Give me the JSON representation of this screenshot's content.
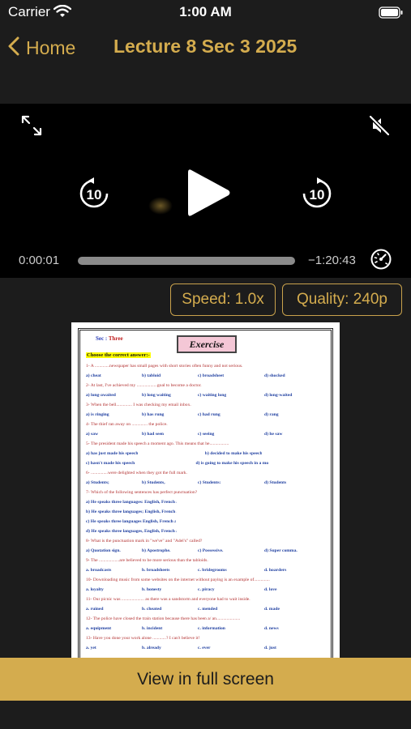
{
  "status": {
    "carrier": "Carrier",
    "time": "1:00 AM"
  },
  "nav": {
    "back_label": "Home",
    "title": "Lecture 8 Sec 3 2025"
  },
  "player": {
    "elapsed": "0:00:01",
    "remaining": "−1:20:43",
    "progress": 0.0002,
    "skip_back": "10",
    "skip_forward": "10"
  },
  "controls": {
    "speed": "Speed: 1.0x",
    "quality": "Quality: 240p"
  },
  "document": {
    "sec_label": "Sec :",
    "sec_value": "Three",
    "heading": "Exercise",
    "instruction": "Choose the correct answer:-",
    "questions": [
      {
        "q": "1- A .............newspaper has small pages with short stories often funny and not serious.",
        "options": [
          "a) cheat",
          "b) tabloid",
          "c) broadsheet",
          "d) shocked"
        ]
      },
      {
        "q": "2- At last, I've achieved my ..................goal to become a doctor.",
        "options": [
          "a) long-awaited",
          "b) long waiting",
          "c) waiting long",
          "d) long-waited"
        ]
      },
      {
        "q": "3- When the bell.............. I was checking my email inbox.",
        "options": [
          "a) is ringing",
          "b) has rung",
          "c) had rung",
          "d) rang"
        ]
      },
      {
        "q": "4- The thief ran away on .............. the police.",
        "options": [
          "a) saw",
          "b) had seen",
          "c) seeing",
          "d) he saw"
        ]
      },
      {
        "q": "5- The president made his speech a moment ago. This means that he.................",
        "options": [
          "a) has just made his speech",
          "",
          "b) decided to make his speech",
          ""
        ]
      },
      {
        "q": "",
        "options": [
          "c) hasn't made his speech yet",
          "",
          "d) is going to make his speech in a moment",
          ""
        ]
      },
      {
        "q": "6- ...............were delighted when they got the full mark.",
        "options": [
          "a) Students;",
          "b) Students,",
          "c) Students:",
          "d) Students"
        ]
      },
      {
        "q": "7- Which of the following sentences has perfect punctuation?",
        "options": [
          "a) He speaks three languages: English, French and Spanish.",
          "",
          "",
          ""
        ]
      },
      {
        "q": "",
        "options": [
          "b) He speaks three languages; English, French and Spanish.",
          "",
          "",
          ""
        ]
      },
      {
        "q": "",
        "options": [
          "c) He speaks three languages English, French and Spanish.",
          "",
          "",
          ""
        ]
      },
      {
        "q": "",
        "options": [
          "d) He speaks three languages, English, French and Spanish.",
          "",
          "",
          ""
        ]
      },
      {
        "q": "8- What is the punctuation mark in \"we've\" and \"Adel's\" called?",
        "options": [
          "a) Quotation sign.",
          "b) Apostrophe.",
          "c) Possessive.",
          "d) Super comma."
        ]
      },
      {
        "q": "9- The ..................are believed to be more serious than the tabloids.",
        "options": [
          "a. broadcasts",
          "b. broadsheets",
          "c. bridegrooms",
          "d. hoarders"
        ]
      },
      {
        "q": "10- Downloading music from some websites on the internet without paying is an example of..............",
        "options": [
          "a. loyalty",
          "b. honesty",
          "c. piracy",
          "d. love"
        ]
      },
      {
        "q": "11- Our picnic was .................... as there was a sandstorm and everyone had to wait inside.",
        "options": [
          "a. ruined",
          "b. cheated",
          "c. mended",
          "d. made"
        ]
      },
      {
        "q": "12- The police have closed the train station because there has been a/ an.....................",
        "options": [
          "a. equipment",
          "b. incident",
          "c. information",
          "d. news"
        ]
      },
      {
        "q": "13- Have you done your work alone ............? I can't believe it!",
        "options": [
          "a. yet",
          "b. already",
          "c. ever",
          "d. just"
        ]
      }
    ]
  },
  "footer": {
    "fullscreen_label": "View in full screen"
  },
  "colors": {
    "accent": "#d4ac4e",
    "background": "#1c1c1c",
    "player": "#000000"
  }
}
